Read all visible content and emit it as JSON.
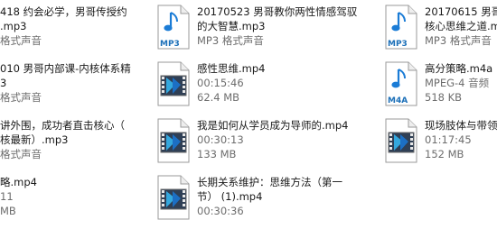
{
  "files": [
    {
      "lines": [
        "418 约会必学，男哥传授约",
        ".mp3",
        "格式声音"
      ]
    },
    {
      "lines": [
        "20170523 男哥教你两性情感驾驭",
        "的大智慧.mp3",
        "MP3 格式声音"
      ],
      "icon": "mp3-file-icon",
      "badge": "MP3"
    },
    {
      "lines": [
        "20170615 男哥",
        "核心思维之道.m",
        "MP3 格式声音"
      ],
      "icon": "mp3-file-icon",
      "badge": "MP3"
    },
    {
      "lines": [
        "010 男哥内部课-内核体系精",
        "3",
        "格式声音"
      ]
    },
    {
      "lines": [
        "感性思维.mp4",
        "00:15:46",
        "62.4 MB"
      ],
      "icon": "video-file-icon"
    },
    {
      "lines": [
        "高分策略.m4a",
        "MPEG-4 音频",
        "518 KB"
      ],
      "icon": "m4a-file-icon",
      "badge": "M4A"
    },
    {
      "lines": [
        "讲外围，成功者直击核心（",
        "核最新）.mp3",
        "格式声音"
      ]
    },
    {
      "lines": [
        "我是如何从学员成为导师的.mp4",
        "00:30:13",
        "133 MB"
      ],
      "icon": "video-file-icon"
    },
    {
      "lines": [
        "现场肢体与带领",
        "01:17:45",
        "152 MB"
      ],
      "icon": "video-file-icon"
    },
    {
      "lines": [
        "略.mp4",
        "11",
        "MB"
      ]
    },
    {
      "lines": [
        "长期关系维护：思维方法（第一",
        "节） (1).mp4",
        "00:30:36"
      ],
      "icon": "video-file-icon"
    }
  ]
}
